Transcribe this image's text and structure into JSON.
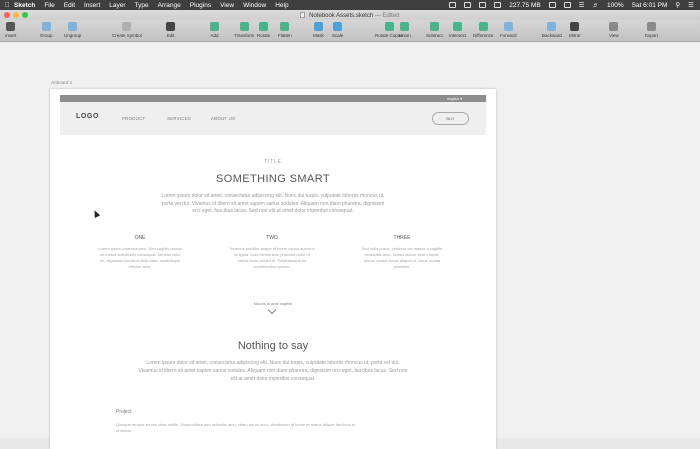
{
  "menubar": {
    "app_name": "Sketch",
    "items": [
      "File",
      "Edit",
      "Insert",
      "Layer",
      "Type",
      "Arrange",
      "Plugins",
      "View",
      "Window",
      "Help"
    ],
    "memory": "227.75 MB",
    "battery": "100%",
    "clock": "Sat 6:01 PM"
  },
  "window": {
    "title": "Notebook Assets.sketch",
    "status": "— Edited"
  },
  "toolbar": {
    "tools": [
      {
        "label": "Insert",
        "color": "#555555"
      },
      {
        "label": "Group",
        "color": "#7fb3dc"
      },
      {
        "label": "Ungroup",
        "color": "#7fb3dc"
      },
      {
        "label": "Create Symbol",
        "color": "#b0b0b0"
      },
      {
        "label": "Edit",
        "color": "#444444"
      },
      {
        "label": "Add",
        "color": "#49b38c"
      },
      {
        "label": "Transform",
        "color": "#49b38c"
      },
      {
        "label": "Rotate",
        "color": "#49b38c"
      },
      {
        "label": "Flatten",
        "color": "#49b38c"
      },
      {
        "label": "Mask",
        "color": "#4aa3d8"
      },
      {
        "label": "Scale",
        "color": "#4aa3d8"
      },
      {
        "label": "Rotate Copies",
        "color": "#49b38c"
      },
      {
        "label": "Union",
        "color": "#49b38c"
      },
      {
        "label": "Subtract",
        "color": "#49b38c"
      },
      {
        "label": "Intersect",
        "color": "#49b38c"
      },
      {
        "label": "Difference",
        "color": "#49b38c"
      },
      {
        "label": "Forward",
        "color": "#7fb3dc"
      },
      {
        "label": "Backward",
        "color": "#7fb3dc"
      },
      {
        "label": "Mirror",
        "color": "#444444"
      },
      {
        "label": "View",
        "color": "#8a8a8a"
      },
      {
        "label": "Export",
        "color": "#8a8a8a"
      }
    ]
  },
  "canvas": {
    "artboard_label": "Artboard 2"
  },
  "artboard": {
    "language": "english",
    "logo": "LOGO",
    "nav": [
      "PRODUCT",
      "SERVICES",
      "ABOUT US"
    ],
    "buy_label": "BUY",
    "small_title": "TITLE",
    "headline": "SOMETHING SMART",
    "intro": "Lorem ipsum dolor sit amet, consectetur adipiscing elit. Nunc dui turpis, vulputate lobortis rhoncus ut, porta vel dui. Vivamus id libero sit amet sapien varius sodales. Aliquam non diam pharetra, dignissim orci eget, faucibus lacus. Sed non elit at amet dolor imperdiet consequat.",
    "columns": [
      {
        "title": "ONE",
        "text": "Lorem ipsum pharetra arcu. Sed sagittis lacinia eu metus sollicitudin consequat. Aenean arcu mi, dignissim interdum felis vitae, scelerisque efficitur arcu."
      },
      {
        "title": "TWO",
        "text": "Vivamus porttitor augue et lorem varius auctor a et ligula. Duis elementum pharetra dolor ut varius dolor ornare et. Pellentesque eu condimentum ipsum."
      },
      {
        "title": "THREE",
        "text": "Sed nulla purus, vehicula vel massa a sagittis venenatis arcu. Donec auctor lorem turpis, rutrum ornare turpis aliquet ut. Nunc ornare pharetra."
      }
    ],
    "cta": "Mauris in ante sagittis",
    "headline2": "Nothing to say",
    "para2": "Lorem ipsum dolor sit amet, consectetur adipiscing elit. Nunc dui turpis, vulputate lobortis rhoncus ut, porta vel dui. Vivamus id libero sit amet sapien varius sodales. Aliquam non diam pharetra, dignissim orci eget, faucibus lacus. Sed non elit at amet dolor imperdiet consequat.",
    "project_title": "Project",
    "project_text": "Quisque tempor eu nisi vitae mollis. Suspendisse sed molestie arcu, vitae rutrum arcu. Vestibulum at lorem et metus aliquet faucibus et et lectus."
  }
}
